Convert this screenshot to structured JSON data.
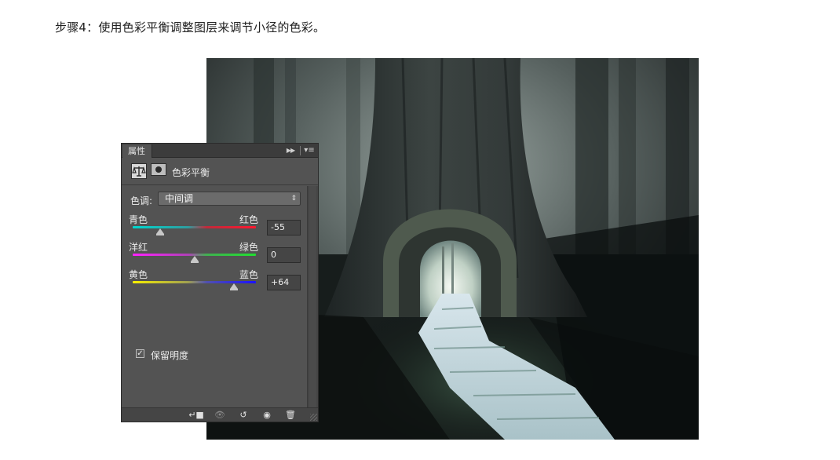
{
  "heading": "步骤4：使用色彩平衡调整图层来调节小径的色彩。",
  "panel": {
    "tab_label": "属性",
    "collapse_icon": "double-chevron-right-icon",
    "menu_icon": "panel-menu-icon",
    "title": "色彩平衡",
    "tone_label": "色调:",
    "tone_value": "中间调",
    "sliders": [
      {
        "left_label": "青色",
        "right_label": "红色",
        "value": "-55",
        "numeric": -55
      },
      {
        "left_label": "洋红",
        "right_label": "绿色",
        "value": "0",
        "numeric": 0
      },
      {
        "left_label": "黄色",
        "right_label": "蓝色",
        "value": "+64",
        "numeric": 64
      }
    ],
    "preserve_label": "保留明度",
    "preserve_checked": true,
    "footer_icons": [
      "clip-to-layer-icon",
      "view-previous-icon",
      "reset-icon",
      "visibility-eye-icon",
      "trash-icon"
    ]
  },
  "colors": {
    "panel_bg": "#535353",
    "panel_dark": "#3c3c3c"
  }
}
